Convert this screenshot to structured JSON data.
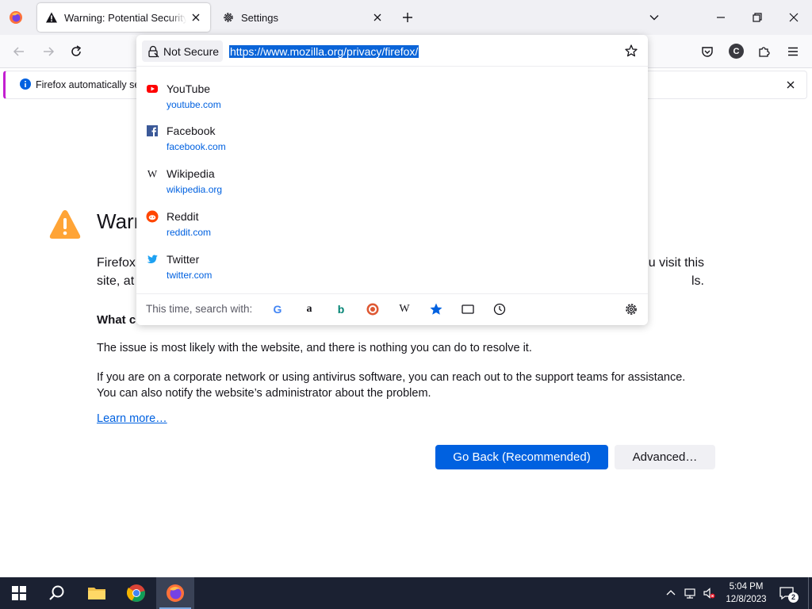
{
  "tabs": [
    {
      "title": "Warning: Potential Security Risk Ahead",
      "active": true,
      "icon": "warning-icon"
    },
    {
      "title": "Settings",
      "active": false,
      "icon": "gear-icon"
    }
  ],
  "urlbar": {
    "security_label": "Not Secure",
    "url": "https://www.mozilla.org/privacy/firefox/"
  },
  "suggestions": [
    {
      "title": "YouTube",
      "url": "youtube.com",
      "icon": "youtube-icon"
    },
    {
      "title": "Facebook",
      "url": "facebook.com",
      "icon": "facebook-icon"
    },
    {
      "title": "Wikipedia",
      "url": "wikipedia.org",
      "icon": "wikipedia-icon"
    },
    {
      "title": "Reddit",
      "url": "reddit.com",
      "icon": "reddit-icon"
    },
    {
      "title": "Twitter",
      "url": "twitter.com",
      "icon": "twitter-icon"
    }
  ],
  "search": {
    "label": "This time, search with:",
    "engines": [
      "google-icon",
      "amazon-icon",
      "bing-icon",
      "duckduckgo-icon",
      "wikipedia-icon",
      "bookmarks-icon",
      "tabs-icon",
      "history-icon"
    ]
  },
  "notification": {
    "text": "Firefox automatically se"
  },
  "page": {
    "title": "Warn",
    "para1_left_1": "Firefox",
    "para1_left_2": "site, at",
    "para1_right_1": "u visit this",
    "para1_right_2": "ls.",
    "what_heading": "What c",
    "para2": "The issue is most likely with the website, and there is nothing you can do to resolve it.",
    "para3_line1": "If you are on a corporate network or using antivirus software, you can reach out to the support teams for assistance.",
    "para3_line2": "You can also notify the website’s administrator about the problem.",
    "learn_more": "Learn more…",
    "go_back": "Go Back (Recommended)",
    "advanced": "Advanced…"
  },
  "taskbar": {
    "time": "5:04 PM",
    "date": "12/8/2023",
    "notification_count": "2"
  },
  "colors": {
    "accent": "#0061e0",
    "selection": "#0a64d8",
    "warning": "#ffa436",
    "taskbar": "#1b2132",
    "notification_border": "#c31fd1"
  }
}
